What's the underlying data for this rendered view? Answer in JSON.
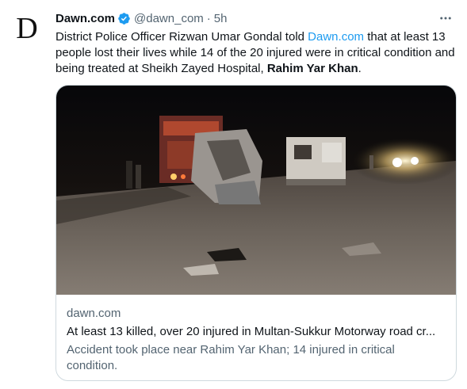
{
  "author": {
    "name": "Dawn.com",
    "handle": "@dawn_com",
    "separator": "·",
    "time": "5h",
    "avatar_letter": "D"
  },
  "tweet": {
    "text_before_link": "District Police Officer Rizwan Umar Gondal told ",
    "link_text": "Dawn.com",
    "text_after_link": " that at least 13 people lost their lives while 14 of the 20 injured were in critical condition and being treated at Sheikh Zayed Hospital, ",
    "bold_text": "Rahim Yar Khan",
    "end_text": "."
  },
  "card": {
    "domain": "dawn.com",
    "title": "At least 13 killed, over 20 injured in Multan-Sukkur Motorway road cr...",
    "description": "Accident took place near Rahim Yar Khan; 14 injured in critical condition."
  },
  "icons": {
    "verified": "verified-badge-icon",
    "more": "more-options-icon"
  },
  "colors": {
    "link": "#1d9bf0",
    "secondary_text": "#536471",
    "primary_text": "#0f1419",
    "border": "#cfd9de"
  }
}
